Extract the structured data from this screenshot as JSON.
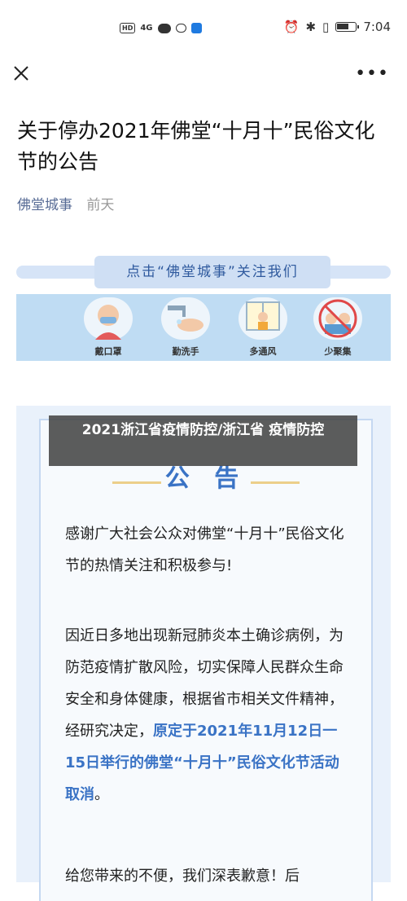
{
  "status_bar": {
    "hd": "HD",
    "signal": "4G",
    "time": "7:04"
  },
  "nav": {
    "close_icon": "close-icon",
    "more_icon": "more-icon"
  },
  "article": {
    "title": "关于停办2021年佛堂“十月十”民俗文化节的公告",
    "account": "佛堂城事",
    "time": "前天"
  },
  "banner": {
    "follow_text": "点击“佛堂城事”关注我们",
    "tips": [
      {
        "label": "戴口罩"
      },
      {
        "label": "勤洗手"
      },
      {
        "label": "多通风"
      },
      {
        "label": "少聚集"
      }
    ]
  },
  "poster": {
    "heading": "公 告",
    "para1": "感谢广大社会公众对佛堂“十月十”民俗文化节的热情关注和积极参与!",
    "para2_normal": "因近日多地出现新冠肺炎本土确诊病例，为防范疫情扩散风险，切实保障人民群众生命安全和身体健康，根据省市相关文件精神，经研究决定，",
    "para2_highlight": "原定于2021年11月12日一15日举行的佛堂“十月十”民俗文化节活动取消",
    "para2_end": "。",
    "para3": "给您带来的不便，我们深表歉意！后"
  },
  "overlay": {
    "text": "2021浙江省疫情防控/浙江省 疫情防控"
  },
  "colors": {
    "accent": "#3a73c5",
    "link": "#576b95"
  }
}
